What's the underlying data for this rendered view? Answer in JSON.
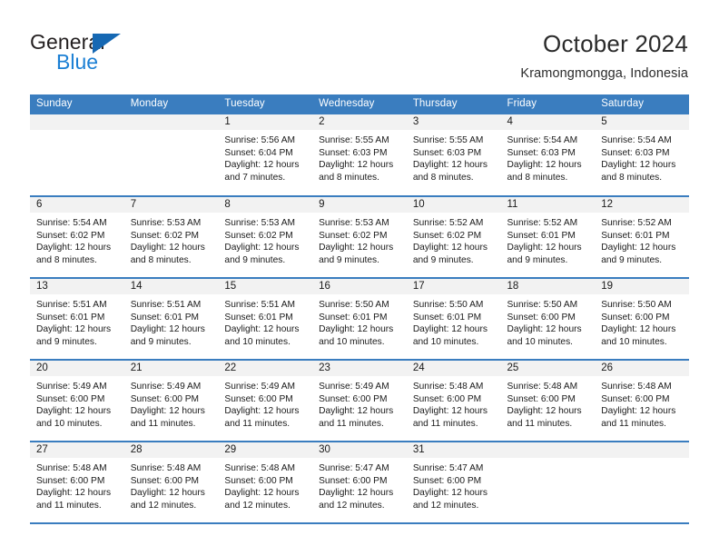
{
  "brand": {
    "name_part1": "General",
    "name_part2": "Blue",
    "triangle_color": "#1668b3",
    "blue_color": "#1b7fd4"
  },
  "header": {
    "title": "October 2024",
    "subtitle": "Kramongmongga, Indonesia"
  },
  "theme": {
    "header_blue": "#3a7dbf",
    "band_gray": "#f2f2f2",
    "text": "#1a1a1a"
  },
  "weekday_headers": [
    "Sunday",
    "Monday",
    "Tuesday",
    "Wednesday",
    "Thursday",
    "Friday",
    "Saturday"
  ],
  "weeks": [
    [
      {
        "day": "",
        "sunrise": "",
        "sunset": "",
        "daylight1": "",
        "daylight2": ""
      },
      {
        "day": "",
        "sunrise": "",
        "sunset": "",
        "daylight1": "",
        "daylight2": ""
      },
      {
        "day": "1",
        "sunrise": "Sunrise: 5:56 AM",
        "sunset": "Sunset: 6:04 PM",
        "daylight1": "Daylight: 12 hours",
        "daylight2": "and 7 minutes."
      },
      {
        "day": "2",
        "sunrise": "Sunrise: 5:55 AM",
        "sunset": "Sunset: 6:03 PM",
        "daylight1": "Daylight: 12 hours",
        "daylight2": "and 8 minutes."
      },
      {
        "day": "3",
        "sunrise": "Sunrise: 5:55 AM",
        "sunset": "Sunset: 6:03 PM",
        "daylight1": "Daylight: 12 hours",
        "daylight2": "and 8 minutes."
      },
      {
        "day": "4",
        "sunrise": "Sunrise: 5:54 AM",
        "sunset": "Sunset: 6:03 PM",
        "daylight1": "Daylight: 12 hours",
        "daylight2": "and 8 minutes."
      },
      {
        "day": "5",
        "sunrise": "Sunrise: 5:54 AM",
        "sunset": "Sunset: 6:03 PM",
        "daylight1": "Daylight: 12 hours",
        "daylight2": "and 8 minutes."
      }
    ],
    [
      {
        "day": "6",
        "sunrise": "Sunrise: 5:54 AM",
        "sunset": "Sunset: 6:02 PM",
        "daylight1": "Daylight: 12 hours",
        "daylight2": "and 8 minutes."
      },
      {
        "day": "7",
        "sunrise": "Sunrise: 5:53 AM",
        "sunset": "Sunset: 6:02 PM",
        "daylight1": "Daylight: 12 hours",
        "daylight2": "and 8 minutes."
      },
      {
        "day": "8",
        "sunrise": "Sunrise: 5:53 AM",
        "sunset": "Sunset: 6:02 PM",
        "daylight1": "Daylight: 12 hours",
        "daylight2": "and 9 minutes."
      },
      {
        "day": "9",
        "sunrise": "Sunrise: 5:53 AM",
        "sunset": "Sunset: 6:02 PM",
        "daylight1": "Daylight: 12 hours",
        "daylight2": "and 9 minutes."
      },
      {
        "day": "10",
        "sunrise": "Sunrise: 5:52 AM",
        "sunset": "Sunset: 6:02 PM",
        "daylight1": "Daylight: 12 hours",
        "daylight2": "and 9 minutes."
      },
      {
        "day": "11",
        "sunrise": "Sunrise: 5:52 AM",
        "sunset": "Sunset: 6:01 PM",
        "daylight1": "Daylight: 12 hours",
        "daylight2": "and 9 minutes."
      },
      {
        "day": "12",
        "sunrise": "Sunrise: 5:52 AM",
        "sunset": "Sunset: 6:01 PM",
        "daylight1": "Daylight: 12 hours",
        "daylight2": "and 9 minutes."
      }
    ],
    [
      {
        "day": "13",
        "sunrise": "Sunrise: 5:51 AM",
        "sunset": "Sunset: 6:01 PM",
        "daylight1": "Daylight: 12 hours",
        "daylight2": "and 9 minutes."
      },
      {
        "day": "14",
        "sunrise": "Sunrise: 5:51 AM",
        "sunset": "Sunset: 6:01 PM",
        "daylight1": "Daylight: 12 hours",
        "daylight2": "and 9 minutes."
      },
      {
        "day": "15",
        "sunrise": "Sunrise: 5:51 AM",
        "sunset": "Sunset: 6:01 PM",
        "daylight1": "Daylight: 12 hours",
        "daylight2": "and 10 minutes."
      },
      {
        "day": "16",
        "sunrise": "Sunrise: 5:50 AM",
        "sunset": "Sunset: 6:01 PM",
        "daylight1": "Daylight: 12 hours",
        "daylight2": "and 10 minutes."
      },
      {
        "day": "17",
        "sunrise": "Sunrise: 5:50 AM",
        "sunset": "Sunset: 6:01 PM",
        "daylight1": "Daylight: 12 hours",
        "daylight2": "and 10 minutes."
      },
      {
        "day": "18",
        "sunrise": "Sunrise: 5:50 AM",
        "sunset": "Sunset: 6:00 PM",
        "daylight1": "Daylight: 12 hours",
        "daylight2": "and 10 minutes."
      },
      {
        "day": "19",
        "sunrise": "Sunrise: 5:50 AM",
        "sunset": "Sunset: 6:00 PM",
        "daylight1": "Daylight: 12 hours",
        "daylight2": "and 10 minutes."
      }
    ],
    [
      {
        "day": "20",
        "sunrise": "Sunrise: 5:49 AM",
        "sunset": "Sunset: 6:00 PM",
        "daylight1": "Daylight: 12 hours",
        "daylight2": "and 10 minutes."
      },
      {
        "day": "21",
        "sunrise": "Sunrise: 5:49 AM",
        "sunset": "Sunset: 6:00 PM",
        "daylight1": "Daylight: 12 hours",
        "daylight2": "and 11 minutes."
      },
      {
        "day": "22",
        "sunrise": "Sunrise: 5:49 AM",
        "sunset": "Sunset: 6:00 PM",
        "daylight1": "Daylight: 12 hours",
        "daylight2": "and 11 minutes."
      },
      {
        "day": "23",
        "sunrise": "Sunrise: 5:49 AM",
        "sunset": "Sunset: 6:00 PM",
        "daylight1": "Daylight: 12 hours",
        "daylight2": "and 11 minutes."
      },
      {
        "day": "24",
        "sunrise": "Sunrise: 5:48 AM",
        "sunset": "Sunset: 6:00 PM",
        "daylight1": "Daylight: 12 hours",
        "daylight2": "and 11 minutes."
      },
      {
        "day": "25",
        "sunrise": "Sunrise: 5:48 AM",
        "sunset": "Sunset: 6:00 PM",
        "daylight1": "Daylight: 12 hours",
        "daylight2": "and 11 minutes."
      },
      {
        "day": "26",
        "sunrise": "Sunrise: 5:48 AM",
        "sunset": "Sunset: 6:00 PM",
        "daylight1": "Daylight: 12 hours",
        "daylight2": "and 11 minutes."
      }
    ],
    [
      {
        "day": "27",
        "sunrise": "Sunrise: 5:48 AM",
        "sunset": "Sunset: 6:00 PM",
        "daylight1": "Daylight: 12 hours",
        "daylight2": "and 11 minutes."
      },
      {
        "day": "28",
        "sunrise": "Sunrise: 5:48 AM",
        "sunset": "Sunset: 6:00 PM",
        "daylight1": "Daylight: 12 hours",
        "daylight2": "and 12 minutes."
      },
      {
        "day": "29",
        "sunrise": "Sunrise: 5:48 AM",
        "sunset": "Sunset: 6:00 PM",
        "daylight1": "Daylight: 12 hours",
        "daylight2": "and 12 minutes."
      },
      {
        "day": "30",
        "sunrise": "Sunrise: 5:47 AM",
        "sunset": "Sunset: 6:00 PM",
        "daylight1": "Daylight: 12 hours",
        "daylight2": "and 12 minutes."
      },
      {
        "day": "31",
        "sunrise": "Sunrise: 5:47 AM",
        "sunset": "Sunset: 6:00 PM",
        "daylight1": "Daylight: 12 hours",
        "daylight2": "and 12 minutes."
      },
      {
        "day": "",
        "sunrise": "",
        "sunset": "",
        "daylight1": "",
        "daylight2": ""
      },
      {
        "day": "",
        "sunrise": "",
        "sunset": "",
        "daylight1": "",
        "daylight2": ""
      }
    ]
  ]
}
